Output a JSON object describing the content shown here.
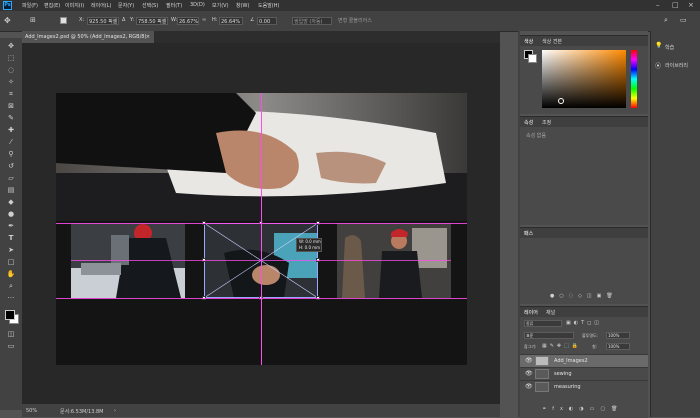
{
  "app": {
    "logo": "Ps"
  },
  "menu": [
    "파일(F)",
    "편집(E)",
    "이미지(I)",
    "레이어(L)",
    "문자(Y)",
    "선택(S)",
    "필터(T)",
    "3D(D)",
    "보기(V)",
    "창(W)",
    "도움말(H)"
  ],
  "options": {
    "x_label": "X:",
    "x_value": "925.50 픽셀",
    "y_label": "Y:",
    "y_value": "758.50 픽셀",
    "w_label": "W:",
    "w_value": "26.67%",
    "h_label": "H:",
    "h_value": "26.64%",
    "angle_value": "0.00",
    "interp": "쌍입방 (자동)",
    "interp2": "변형 콜블리어스"
  },
  "document": {
    "tab_title": "Add_Images2.psd @ 50% (Add_Images2, RGB/8)",
    "close": "×",
    "tooltip_line1": "W: 0.0 mm",
    "tooltip_line2": "H: 0.0 mm"
  },
  "status": {
    "zoom": "50%",
    "doc_info": "문서:6.53M/13.8M"
  },
  "panels": {
    "color_tab": "색상",
    "swatch_tab": "색상 견본",
    "properties_tab": "속성",
    "adjust_tab": "조정",
    "properties_empty": "속성 없음",
    "paths_tab": "패스",
    "layers_tab": "레이어",
    "channels_tab": "채널",
    "kind_label": "종류",
    "blend_mode": "표준",
    "opacity_label": "불투명도:",
    "opacity_value": "100%",
    "lock_label": "잠그기:",
    "fill_label": "칠:",
    "fill_value": "100%",
    "layers": [
      {
        "name": "Add_Images2"
      },
      {
        "name": "sewing"
      },
      {
        "name": "measuring"
      }
    ]
  },
  "right_col": {
    "learn": "학습",
    "libraries": "라이브러리"
  },
  "colors": {
    "accent": "#ff4cf0",
    "app_bg": "#535353",
    "panel": "#424242"
  }
}
